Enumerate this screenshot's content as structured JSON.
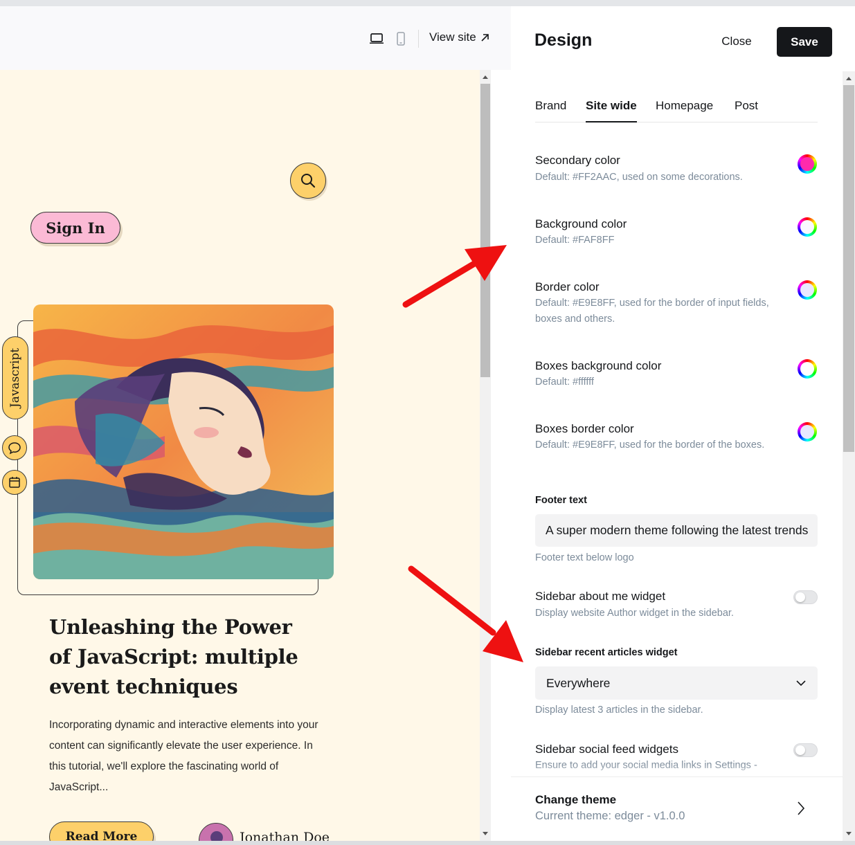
{
  "preview": {
    "view_site_label": "View site",
    "sign_in_label": "Sign In",
    "tag_label": "Javascript",
    "post_title": "Unleashing the Power of JavaScript: multiple event techniques",
    "excerpt": "Incorporating dynamic and interactive elements into your content can significantly elevate the user experience. In this tutorial, we'll explore the fascinating world of JavaScript...",
    "read_more_label": "Read More",
    "author_name": "Jonathan Doe",
    "accent_color": "#fdd06a",
    "signin_color": "#fbbad5",
    "background_color": "#fff8e8"
  },
  "panel": {
    "title": "Design",
    "close_label": "Close",
    "save_label": "Save",
    "tabs": [
      "Brand",
      "Site wide",
      "Homepage",
      "Post"
    ],
    "active_tab": "Site wide",
    "colors": [
      {
        "label": "Secondary color",
        "desc": "Default: #FF2AAC, used on some decorations.",
        "value": "#FF2AAC"
      },
      {
        "label": "Background color",
        "desc": "Default: #FAF8FF",
        "value": "#FAF8FF"
      },
      {
        "label": "Border color",
        "desc": "Default: #E9E8FF, used for the border of input fields, boxes and others.",
        "value": "#E9E8FF"
      },
      {
        "label": "Boxes background color",
        "desc": "Default: #ffffff",
        "value": "#ffffff"
      },
      {
        "label": "Boxes border color",
        "desc": "Default: #E9E8FF, used for the border of the boxes.",
        "value": "#E9E8FF"
      }
    ],
    "footer_text": {
      "label": "Footer text",
      "value": "A super modern theme following the latest trends",
      "help": "Footer text below logo"
    },
    "about_widget": {
      "label": "Sidebar about me widget",
      "desc": "Display website Author widget in the sidebar.",
      "enabled": false
    },
    "recent_widget": {
      "label": "Sidebar recent articles widget",
      "value": "Everywhere",
      "help": "Display latest 3 articles in the sidebar."
    },
    "social_widget": {
      "label": "Sidebar social feed widgets",
      "desc": "Ensure to add your social media links in Settings -",
      "enabled": false
    },
    "change_theme": {
      "title": "Change theme",
      "current": "Current theme: edger - v1.0.0"
    }
  }
}
